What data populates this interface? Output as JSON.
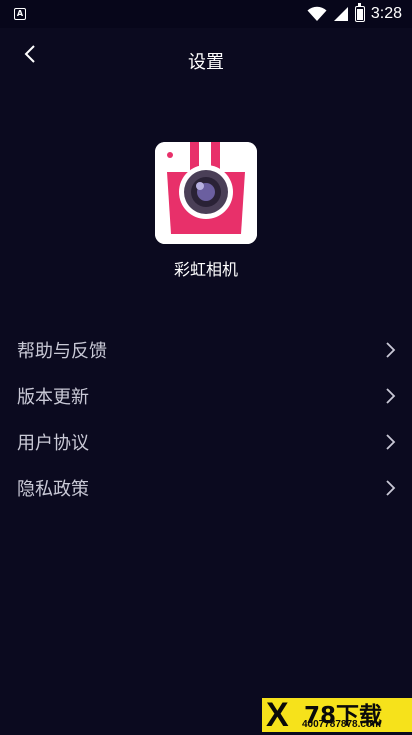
{
  "status_bar": {
    "time": "3:28"
  },
  "header": {
    "title": "设置",
    "back_icon": "chevron-left-icon"
  },
  "app": {
    "name": "彩虹相机",
    "icon": "camera-app-icon",
    "accent": "#e8306a"
  },
  "menu": {
    "items": [
      {
        "label": "帮助与反馈",
        "icon": "chevron-right-icon"
      },
      {
        "label": "版本更新",
        "icon": "chevron-right-icon"
      },
      {
        "label": "用户协议",
        "icon": "chevron-right-icon"
      },
      {
        "label": "隐私政策",
        "icon": "chevron-right-icon"
      }
    ]
  },
  "watermark": {
    "mark": "X",
    "main": "78下载",
    "sub": "4007787878.com",
    "bg": "#f6e21b"
  },
  "colors": {
    "background": "#0b0a1f",
    "label": "#c9c9d6"
  }
}
